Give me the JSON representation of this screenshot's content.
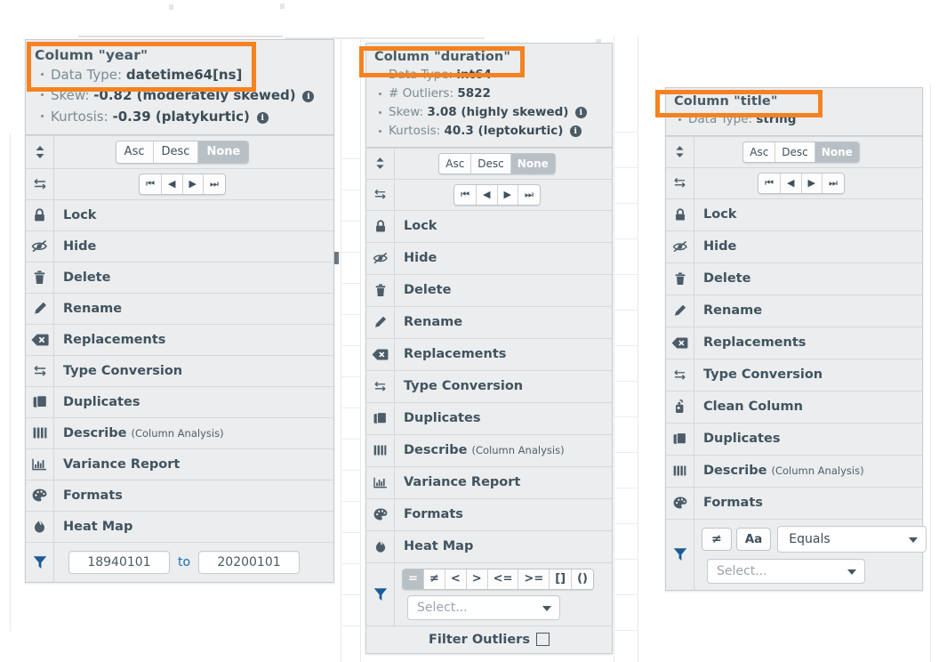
{
  "theme": {
    "panel_bg": "#ebedee",
    "border": "#c8ccce",
    "text": "#41535f",
    "muted": "#7a8b94",
    "highlight": "#f58220",
    "filter_icon": "#1a5c96",
    "link": "#1a6fb5"
  },
  "menus": [
    {
      "id": "year",
      "title": "Column \"year\"",
      "details": [
        {
          "label": "Data Type:",
          "value": "datetime64[ns]",
          "info": false
        },
        {
          "label": "Skew:",
          "value": "-0.82 (moderately skewed)",
          "info": true
        },
        {
          "label": "Kurtosis:",
          "value": "-0.39 (platykurtic)",
          "info": true
        }
      ],
      "sort": {
        "icon": "sort-icon",
        "options": [
          "Asc",
          "Desc",
          "None"
        ],
        "selected": "None"
      },
      "move": {
        "icon": "move-icon",
        "options": [
          "first",
          "prev",
          "next",
          "last"
        ]
      },
      "items": [
        {
          "icon": "lock-icon",
          "label": "Lock"
        },
        {
          "icon": "hide-icon",
          "label": "Hide"
        },
        {
          "icon": "delete-icon",
          "label": "Delete"
        },
        {
          "icon": "rename-icon",
          "label": "Rename"
        },
        {
          "icon": "replacements-icon",
          "label": "Replacements"
        },
        {
          "icon": "type-conversion-icon",
          "label": "Type Conversion"
        },
        {
          "icon": "duplicates-icon",
          "label": "Duplicates"
        },
        {
          "icon": "describe-icon",
          "label": "Describe",
          "sub": "(Column Analysis)"
        },
        {
          "icon": "variance-report-icon",
          "label": "Variance Report"
        },
        {
          "icon": "formats-icon",
          "label": "Formats"
        },
        {
          "icon": "heat-map-icon",
          "label": "Heat Map"
        }
      ],
      "filter": {
        "icon": "filter-icon",
        "type": "range",
        "from_value": "18940101",
        "to_label": "to",
        "to_value": "20200101"
      }
    },
    {
      "id": "duration",
      "title": "Column \"duration\"",
      "details": [
        {
          "label": "Data Type:",
          "value": "int64",
          "info": false
        },
        {
          "label": "# Outliers:",
          "value": "5822",
          "info": false
        },
        {
          "label": "Skew:",
          "value": "3.08 (highly skewed)",
          "info": true
        },
        {
          "label": "Kurtosis:",
          "value": "40.3 (leptokurtic)",
          "info": true
        }
      ],
      "sort": {
        "icon": "sort-icon",
        "options": [
          "Asc",
          "Desc",
          "None"
        ],
        "selected": "None"
      },
      "move": {
        "icon": "move-icon",
        "options": [
          "first",
          "prev",
          "next",
          "last"
        ]
      },
      "items": [
        {
          "icon": "lock-icon",
          "label": "Lock"
        },
        {
          "icon": "hide-icon",
          "label": "Hide"
        },
        {
          "icon": "delete-icon",
          "label": "Delete"
        },
        {
          "icon": "rename-icon",
          "label": "Rename"
        },
        {
          "icon": "replacements-icon",
          "label": "Replacements"
        },
        {
          "icon": "type-conversion-icon",
          "label": "Type Conversion"
        },
        {
          "icon": "duplicates-icon",
          "label": "Duplicates"
        },
        {
          "icon": "describe-icon",
          "label": "Describe",
          "sub": "(Column Analysis)"
        },
        {
          "icon": "variance-report-icon",
          "label": "Variance Report"
        },
        {
          "icon": "formats-icon",
          "label": "Formats"
        },
        {
          "icon": "heat-map-icon",
          "label": "Heat Map"
        }
      ],
      "filter": {
        "icon": "filter-icon",
        "type": "operators",
        "operators": [
          "=",
          "≠",
          "<",
          ">",
          "<=",
          ">=",
          "[]",
          "()"
        ],
        "selected_operator": "=",
        "select_placeholder": "Select...",
        "outliers_label": "Filter Outliers",
        "outliers_checked": false
      }
    },
    {
      "id": "title",
      "title": "Column \"title\"",
      "details": [
        {
          "label": "Data Type:",
          "value": "string",
          "info": false
        }
      ],
      "sort": {
        "icon": "sort-icon",
        "options": [
          "Asc",
          "Desc",
          "None"
        ],
        "selected": "None"
      },
      "move": {
        "icon": "move-icon",
        "options": [
          "first",
          "prev",
          "next",
          "last"
        ]
      },
      "items": [
        {
          "icon": "lock-icon",
          "label": "Lock"
        },
        {
          "icon": "hide-icon",
          "label": "Hide"
        },
        {
          "icon": "delete-icon",
          "label": "Delete"
        },
        {
          "icon": "rename-icon",
          "label": "Rename"
        },
        {
          "icon": "replacements-icon",
          "label": "Replacements"
        },
        {
          "icon": "type-conversion-icon",
          "label": "Type Conversion"
        },
        {
          "icon": "clean-column-icon",
          "label": "Clean Column"
        },
        {
          "icon": "duplicates-icon",
          "label": "Duplicates"
        },
        {
          "icon": "describe-icon",
          "label": "Describe",
          "sub": "(Column Analysis)"
        },
        {
          "icon": "formats-icon",
          "label": "Formats"
        }
      ],
      "filter": {
        "icon": "filter-icon",
        "type": "string",
        "negate_label": "≠",
        "case_label": "Aa",
        "mode_value": "Equals",
        "select_placeholder": "Select..."
      }
    }
  ],
  "highlights": [
    {
      "target": "year-header"
    },
    {
      "target": "duration-title"
    },
    {
      "target": "title-title"
    }
  ]
}
